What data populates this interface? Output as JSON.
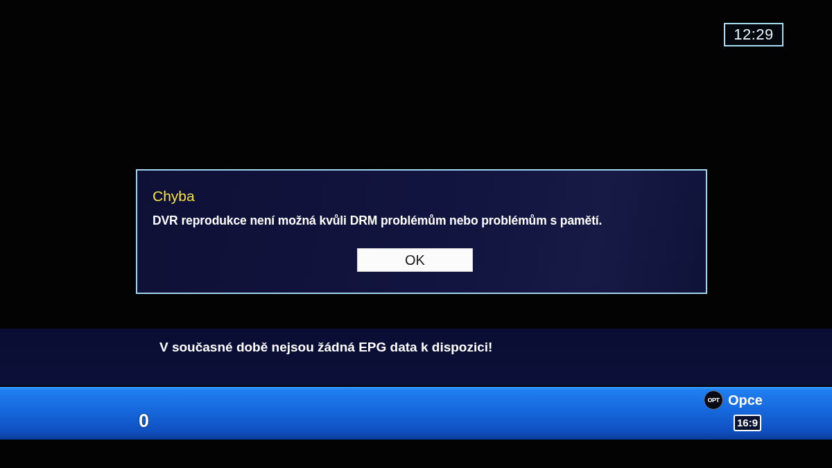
{
  "clock": {
    "time": "12:29"
  },
  "dialog": {
    "title": "Chyba",
    "message": "DVR reprodukce není možná kvůli DRM problémům nebo problémům s pamětí.",
    "button": "OK"
  },
  "info_banner": {
    "text": "V současné době nejsou žádná EPG data k dispozici!"
  },
  "status_bar": {
    "channel_number": "0",
    "option_key": "OPT",
    "option_label": "Opce",
    "aspect_ratio": "16:9"
  }
}
